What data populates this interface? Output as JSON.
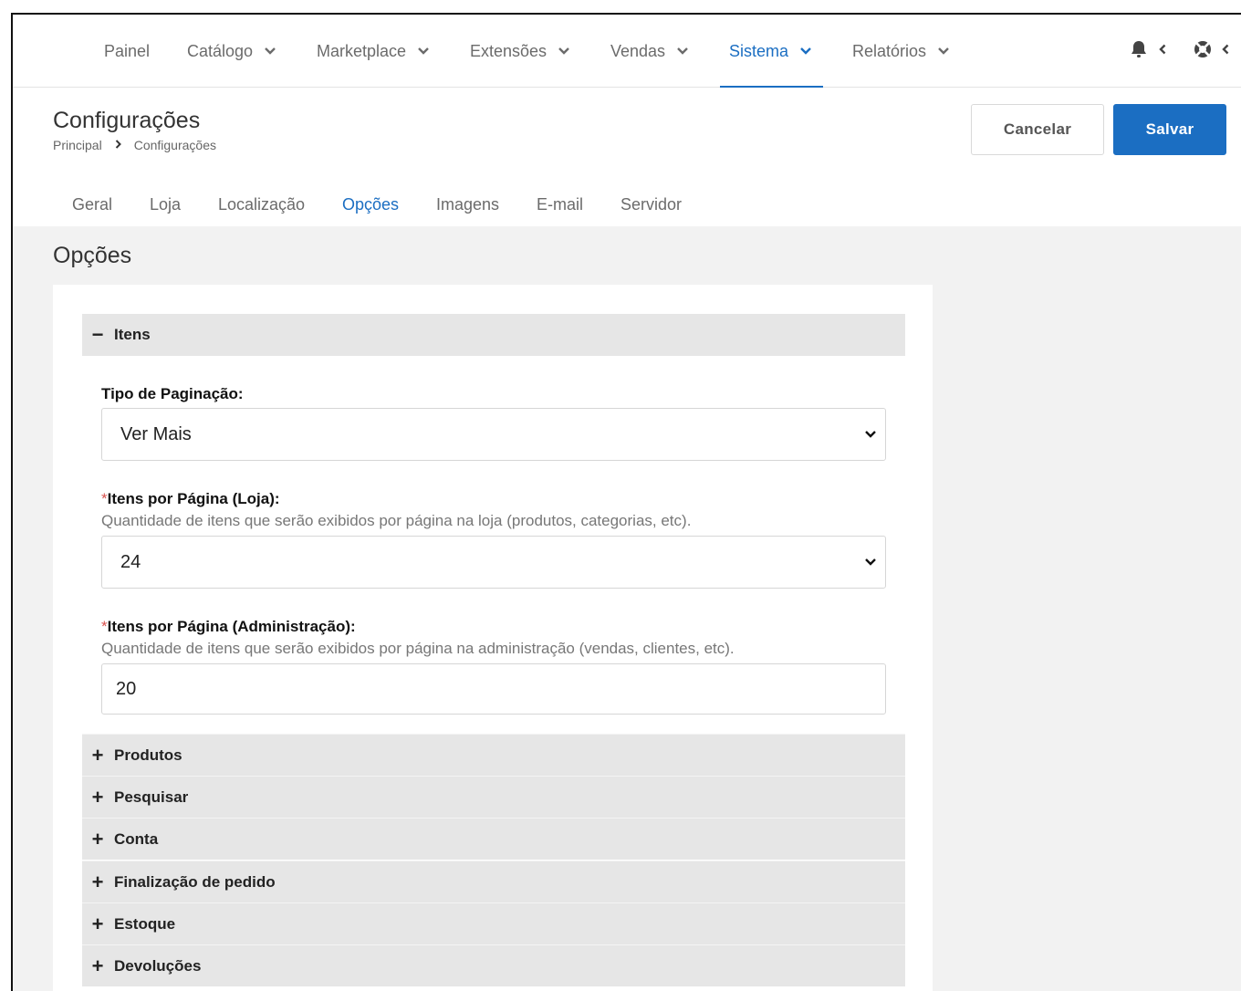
{
  "nav": {
    "items": [
      {
        "label": "Painel",
        "dropdown": false,
        "active": false
      },
      {
        "label": "Catálogo",
        "dropdown": true,
        "active": false
      },
      {
        "label": "Marketplace",
        "dropdown": true,
        "active": false
      },
      {
        "label": "Extensões",
        "dropdown": true,
        "active": false
      },
      {
        "label": "Vendas",
        "dropdown": true,
        "active": false
      },
      {
        "label": "Sistema",
        "dropdown": true,
        "active": true
      },
      {
        "label": "Relatórios",
        "dropdown": true,
        "active": false
      }
    ],
    "right_icons": [
      "bell-icon",
      "chevron-left-icon",
      "help-lifebuoy-icon",
      "chevron-left-icon"
    ]
  },
  "header": {
    "title": "Configurações",
    "breadcrumb": [
      "Principal",
      "Configurações"
    ],
    "cancel_label": "Cancelar",
    "save_label": "Salvar"
  },
  "tabs": [
    {
      "label": "Geral",
      "active": false
    },
    {
      "label": "Loja",
      "active": false
    },
    {
      "label": "Localização",
      "active": false
    },
    {
      "label": "Opções",
      "active": true
    },
    {
      "label": "Imagens",
      "active": false
    },
    {
      "label": "E-mail",
      "active": false
    },
    {
      "label": "Servidor",
      "active": false
    }
  ],
  "section": {
    "title": "Opções",
    "open_panel": {
      "symbol": "−",
      "title": "Itens",
      "fields": [
        {
          "required": false,
          "label": "Tipo de Paginação:",
          "help": "",
          "type": "select",
          "value": "Ver Mais"
        },
        {
          "required": true,
          "required_mark": "*",
          "label": "Itens por Página (Loja):",
          "help": "Quantidade de itens que serão exibidos por página na loja (produtos, categorias, etc).",
          "type": "select",
          "value": "24"
        },
        {
          "required": true,
          "required_mark": "*",
          "label": "Itens por Página (Administração):",
          "help": "Quantidade de itens que serão exibidos por página na administração (vendas, clientes, etc).",
          "type": "input",
          "value": "20"
        }
      ]
    },
    "collapsed_panels": [
      {
        "symbol": "+",
        "title": "Produtos"
      },
      {
        "symbol": "+",
        "title": "Pesquisar"
      },
      {
        "symbol": "+",
        "title": "Conta"
      },
      {
        "symbol": "+",
        "title": "Finalização de pedido"
      },
      {
        "symbol": "+",
        "title": "Estoque"
      },
      {
        "symbol": "+",
        "title": "Devoluções"
      }
    ]
  },
  "colors": {
    "accent": "#1b6ec2",
    "panel_bg": "#e6e6e6",
    "content_bg": "#f2f2f2",
    "required": "#d9534f"
  }
}
